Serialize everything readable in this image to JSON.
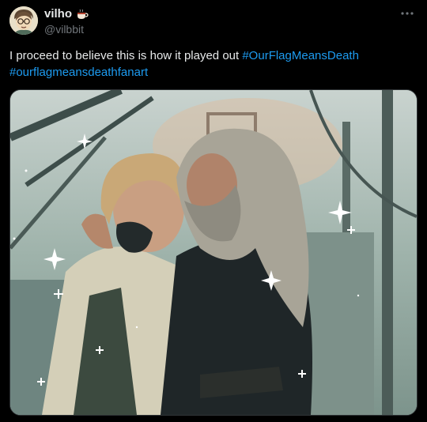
{
  "author": {
    "display_name": "vilho",
    "name_emoji": "cup-icon",
    "handle": "@vilbbit",
    "avatar": "avatar-illustration"
  },
  "menu": {
    "icon": "more-options-icon"
  },
  "tweet": {
    "text": "I proceed to believe this is how it played out",
    "hashtags": [
      "#OurFlagMeansDeath",
      "#ourflagmeansdeathfanart"
    ]
  },
  "media": {
    "type": "image",
    "description_icon": "fanart-illustration"
  },
  "colors": {
    "background": "#000000",
    "text": "#e7e9ea",
    "secondary": "#71767b",
    "link": "#1d9bf0"
  }
}
